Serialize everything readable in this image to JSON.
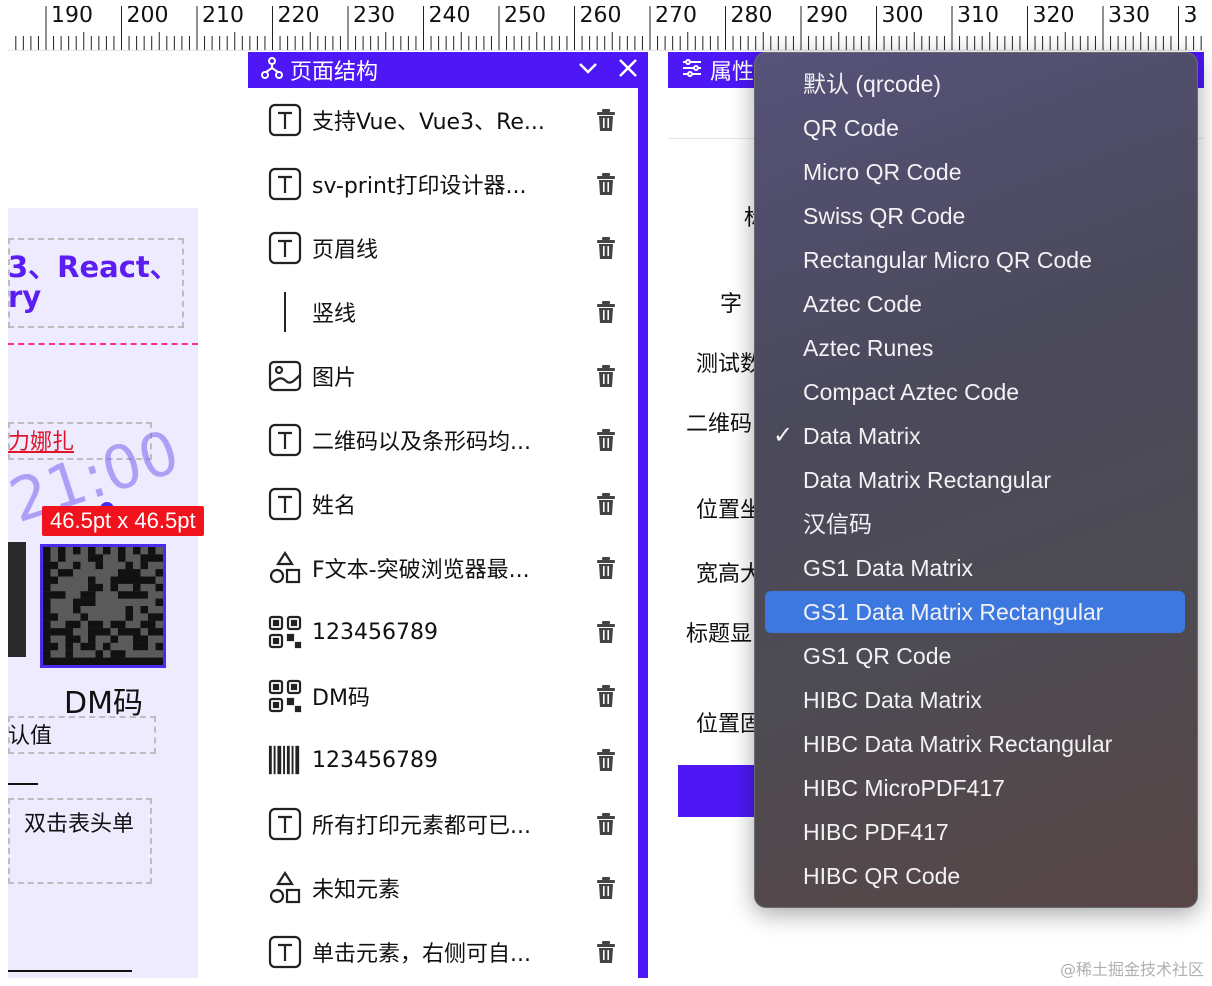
{
  "ruler": {
    "ticks": [
      "190",
      "200",
      "210",
      "220",
      "230",
      "240",
      "250",
      "260",
      "270",
      "280",
      "290",
      "300",
      "310",
      "320",
      "330",
      "3"
    ]
  },
  "canvas": {
    "react_text": "3、React、",
    "react_text2": "ry",
    "red_link": "力娜扎",
    "watermark": "21:00",
    "size_badge": "46.5pt x 46.5pt",
    "dm_label": "DM码",
    "default_value": "认值",
    "dbl_click": "双击表头单"
  },
  "structure_panel": {
    "title": "页面结构",
    "items": [
      {
        "icon": "text-icon",
        "label": "支持Vue、Vue3、Re..."
      },
      {
        "icon": "text-icon",
        "label": "sv-print打印设计器..."
      },
      {
        "icon": "text-icon",
        "label": "页眉线"
      },
      {
        "icon": "vline-icon",
        "label": "竖线"
      },
      {
        "icon": "image-icon",
        "label": "图片"
      },
      {
        "icon": "text-icon",
        "label": "二维码以及条形码均..."
      },
      {
        "icon": "text-icon",
        "label": "姓名"
      },
      {
        "icon": "shapes-icon",
        "label": "F文本-突破浏览器最..."
      },
      {
        "icon": "qrcode-icon",
        "label": "123456789"
      },
      {
        "icon": "qrcode-icon",
        "label": "DM码"
      },
      {
        "icon": "barcode-icon",
        "label": "123456789"
      },
      {
        "icon": "text-icon",
        "label": "所有打印元素都可已..."
      },
      {
        "icon": "shapes-icon",
        "label": "未知元素"
      },
      {
        "icon": "text-icon",
        "label": "单击元素，右侧可自..."
      }
    ]
  },
  "properties_panel": {
    "title": "属性",
    "labels": [
      "标",
      "字",
      "测试数",
      "二维码",
      "位置坐",
      "宽高大",
      "标题显",
      "位置固"
    ]
  },
  "dropdown": {
    "selected": "Data Matrix",
    "highlighted": "GS1 Data Matrix Rectangular",
    "options": [
      "默认 (qrcode)",
      "QR Code",
      "Micro QR Code",
      "Swiss QR Code",
      "Rectangular Micro QR Code",
      "Aztec Code",
      "Aztec Runes",
      "Compact Aztec Code",
      "Data Matrix",
      "Data Matrix Rectangular",
      "汉信码",
      "GS1 Data Matrix",
      "GS1 Data Matrix Rectangular",
      "GS1 QR Code",
      "HIBC Data Matrix",
      "HIBC Data Matrix Rectangular",
      "HIBC MicroPDF417",
      "HIBC PDF417",
      "HIBC QR Code"
    ]
  },
  "site_mark": "@稀土掘金技术社区",
  "colors": {
    "accent": "#4d18f5",
    "selection": "#3d78e0",
    "size_badge": "#f0131e"
  }
}
